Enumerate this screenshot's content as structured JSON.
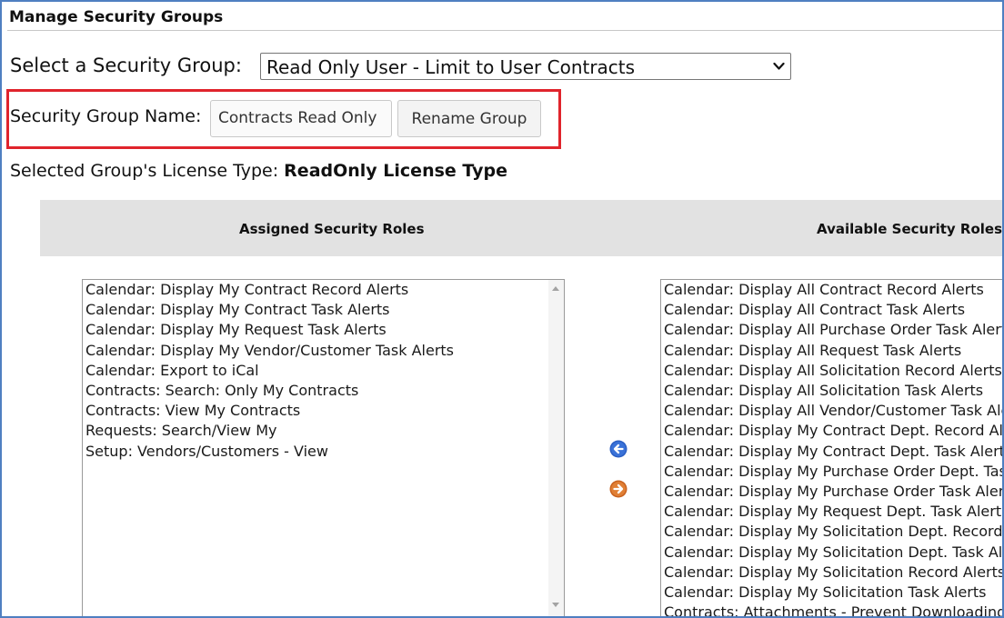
{
  "page": {
    "title": "Manage Security Groups"
  },
  "group_select": {
    "label": "Select a Security Group:",
    "selected": "Read Only User - Limit to User Contracts"
  },
  "group_name": {
    "label": "Security Group Name:",
    "value": "Contracts Read Only",
    "rename_label": "Rename Group"
  },
  "license": {
    "label": "Selected Group's License Type:",
    "value": "ReadOnly License Type"
  },
  "roles": {
    "assigned_header": "Assigned Security Roles",
    "available_header": "Available Security Roles",
    "assigned": [
      "Calendar: Display My Contract Record Alerts",
      "Calendar: Display My Contract Task Alerts",
      "Calendar: Display My Request Task Alerts",
      "Calendar: Display My Vendor/Customer Task Alerts",
      "Calendar: Export to iCal",
      "Contracts: Search: Only My Contracts",
      "Contracts: View My Contracts",
      "Requests: Search/View My",
      "Setup: Vendors/Customers - View"
    ],
    "available": [
      "Calendar: Display All Contract Record Alerts",
      "Calendar: Display All Contract Task Alerts",
      "Calendar: Display All Purchase Order Task Alerts",
      "Calendar: Display All Request Task Alerts",
      "Calendar: Display All Solicitation Record Alerts",
      "Calendar: Display All Solicitation Task Alerts",
      "Calendar: Display All Vendor/Customer Task Alerts",
      "Calendar: Display My Contract Dept. Record Alerts",
      "Calendar: Display My Contract Dept. Task Alerts",
      "Calendar: Display My Purchase Order Dept. Task Alerts",
      "Calendar: Display My Purchase Order Task Alerts",
      "Calendar: Display My Request Dept. Task Alerts",
      "Calendar: Display My Solicitation Dept. Record Alerts",
      "Calendar: Display My Solicitation Dept. Task Alerts",
      "Calendar: Display My Solicitation Record Alerts",
      "Calendar: Display My Solicitation Task Alerts",
      "Contracts: Attachments - Prevent Downloading"
    ]
  },
  "colors": {
    "highlight": "#e0242c",
    "frame": "#4f7fc1",
    "header_bg": "#e2e2e2",
    "arrow_left": "#2b5fc4",
    "arrow_right": "#d9752c"
  },
  "icons": {
    "remove": "arrow-left-icon",
    "add": "arrow-right-icon",
    "dropdown": "chevron-down-icon"
  }
}
